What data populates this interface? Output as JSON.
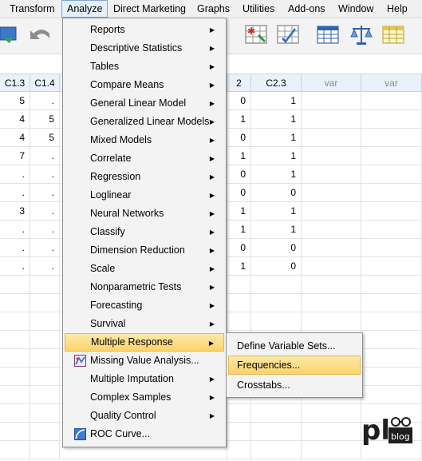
{
  "menubar": [
    "Transform",
    "Analyze",
    "Direct Marketing",
    "Graphs",
    "Utilities",
    "Add-ons",
    "Window",
    "Help"
  ],
  "toolbar_icons": [
    "open-data-icon",
    "undo-icon",
    "select-cases-icon",
    "weight-cases-icon",
    "value-labels-icon",
    "balance-icon",
    "variable-sets-icon"
  ],
  "grid": {
    "headers": [
      "C1.3",
      "C1.4",
      "",
      "2",
      "C2.3",
      "var",
      "var"
    ],
    "rows": [
      [
        "5",
        ".",
        "0",
        "1"
      ],
      [
        "4",
        "5",
        "1",
        "1"
      ],
      [
        "4",
        "5",
        "0",
        "1"
      ],
      [
        "7",
        ".",
        "1",
        "1"
      ],
      [
        ".",
        ".",
        "0",
        "1"
      ],
      [
        ".",
        ".",
        "0",
        "0"
      ],
      [
        "3",
        ".",
        "1",
        "1"
      ],
      [
        ".",
        ".",
        "1",
        "1"
      ],
      [
        ".",
        ".",
        "0",
        "0"
      ],
      [
        ".",
        ".",
        "1",
        "0"
      ]
    ]
  },
  "analyze_menu": [
    {
      "label": "Reports",
      "submenu": true
    },
    {
      "label": "Descriptive Statistics",
      "submenu": true
    },
    {
      "label": "Tables",
      "submenu": true
    },
    {
      "label": "Compare Means",
      "submenu": true
    },
    {
      "label": "General Linear Model",
      "submenu": true
    },
    {
      "label": "Generalized Linear Models",
      "submenu": true
    },
    {
      "label": "Mixed Models",
      "submenu": true
    },
    {
      "label": "Correlate",
      "submenu": true
    },
    {
      "label": "Regression",
      "submenu": true
    },
    {
      "label": "Loglinear",
      "submenu": true
    },
    {
      "label": "Neural Networks",
      "submenu": true
    },
    {
      "label": "Classify",
      "submenu": true
    },
    {
      "label": "Dimension Reduction",
      "submenu": true
    },
    {
      "label": "Scale",
      "submenu": true
    },
    {
      "label": "Nonparametric Tests",
      "submenu": true
    },
    {
      "label": "Forecasting",
      "submenu": true
    },
    {
      "label": "Survival",
      "submenu": true
    },
    {
      "label": "Multiple Response",
      "submenu": true,
      "highlighted": true
    },
    {
      "label": "Missing Value Analysis...",
      "submenu": false,
      "icon": "missing-value-icon"
    },
    {
      "label": "Multiple Imputation",
      "submenu": true
    },
    {
      "label": "Complex Samples",
      "submenu": true
    },
    {
      "label": "Quality Control",
      "submenu": true
    },
    {
      "label": "ROC Curve...",
      "submenu": false,
      "icon": "roc-curve-icon"
    }
  ],
  "multiple_response_submenu": [
    {
      "label": "Define Variable Sets..."
    },
    {
      "label": "Frequencies...",
      "highlighted": true
    },
    {
      "label": "Crosstabs..."
    }
  ],
  "logo": {
    "letters": "pl",
    "sub": "blog"
  },
  "colors": {
    "highlight": "#fbd36b",
    "header_bg": "#eaf1fa",
    "menu_bg": "#f3f3f3"
  }
}
